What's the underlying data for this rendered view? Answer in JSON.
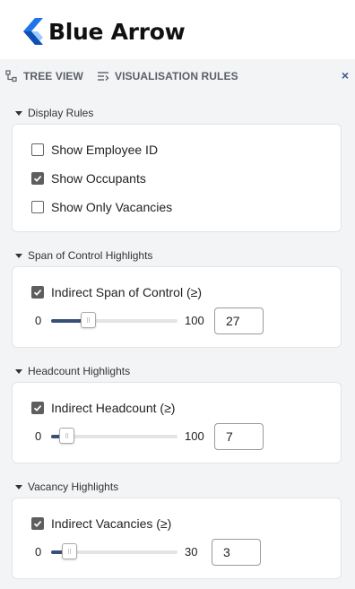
{
  "app": {
    "brand_name": "Blue Arrow",
    "brand_color": "#1e74e8"
  },
  "tabs": [
    {
      "label": "TREE VIEW",
      "icon": "tree-view-icon"
    },
    {
      "label": "VISUALISATION RULES",
      "icon": "visualisation-rules-icon"
    }
  ],
  "close_label": "×",
  "display_rules": {
    "heading": "Display Rules",
    "options": [
      {
        "label": "Show Employee ID",
        "checked": false
      },
      {
        "label": "Show Occupants",
        "checked": true
      },
      {
        "label": "Show Only Vacancies",
        "checked": false
      }
    ]
  },
  "span_of_control": {
    "heading": "Span of Control Highlights",
    "checkbox_label": "Indirect Span of Control (≥)",
    "checked": true,
    "min": "0",
    "max": "100",
    "value": "27"
  },
  "headcount": {
    "heading": "Headcount Highlights",
    "checkbox_label": "Indirect Headcount (≥)",
    "checked": true,
    "min": "0",
    "max": "100",
    "value": "7"
  },
  "vacancy": {
    "heading": "Vacancy Highlights",
    "checkbox_label": "Indirect Vacancies (≥)",
    "checked": true,
    "min": "0",
    "max": "30",
    "value": "3"
  },
  "colors": {
    "slider_fill": "#3a4f78",
    "checkbox_checked": "#5e5e5e",
    "close_icon": "#3a5a8c"
  }
}
